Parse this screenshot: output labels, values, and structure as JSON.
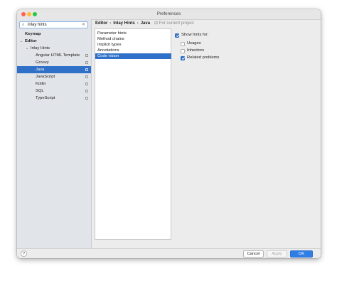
{
  "window": {
    "title": "Preferences"
  },
  "search": {
    "value": "inlay hints"
  },
  "sidebar": {
    "items": [
      {
        "label": "Keymap"
      },
      {
        "label": "Editor"
      },
      {
        "label": "Inlay Hints"
      },
      {
        "label": "Angular HTML Template"
      },
      {
        "label": "Groovy"
      },
      {
        "label": "Java",
        "selected": true
      },
      {
        "label": "JavaScript"
      },
      {
        "label": "Kotlin"
      },
      {
        "label": "SQL"
      },
      {
        "label": "TypeScript"
      }
    ]
  },
  "breadcrumb": {
    "items": [
      "Editor",
      "Inlay Hints",
      "Java"
    ],
    "separator": "›",
    "scope": "For current project"
  },
  "hints_list": {
    "items": [
      "Parameter hints",
      "Method chains",
      "Implicit types",
      "Annotations",
      "Code vision"
    ],
    "selected": "Code vision"
  },
  "options": {
    "show_hints": {
      "label": "Show hints for:",
      "checked": true
    },
    "children": [
      {
        "label": "Usages",
        "checked": false
      },
      {
        "label": "Inheritors",
        "checked": false
      },
      {
        "label": "Related problems",
        "checked": true
      }
    ]
  },
  "footer": {
    "help": "?",
    "cancel": "Cancel",
    "apply": "Apply",
    "ok": "OK"
  },
  "colors": {
    "selection": "#2f70c8",
    "ok_button": "#2f7ee6"
  }
}
